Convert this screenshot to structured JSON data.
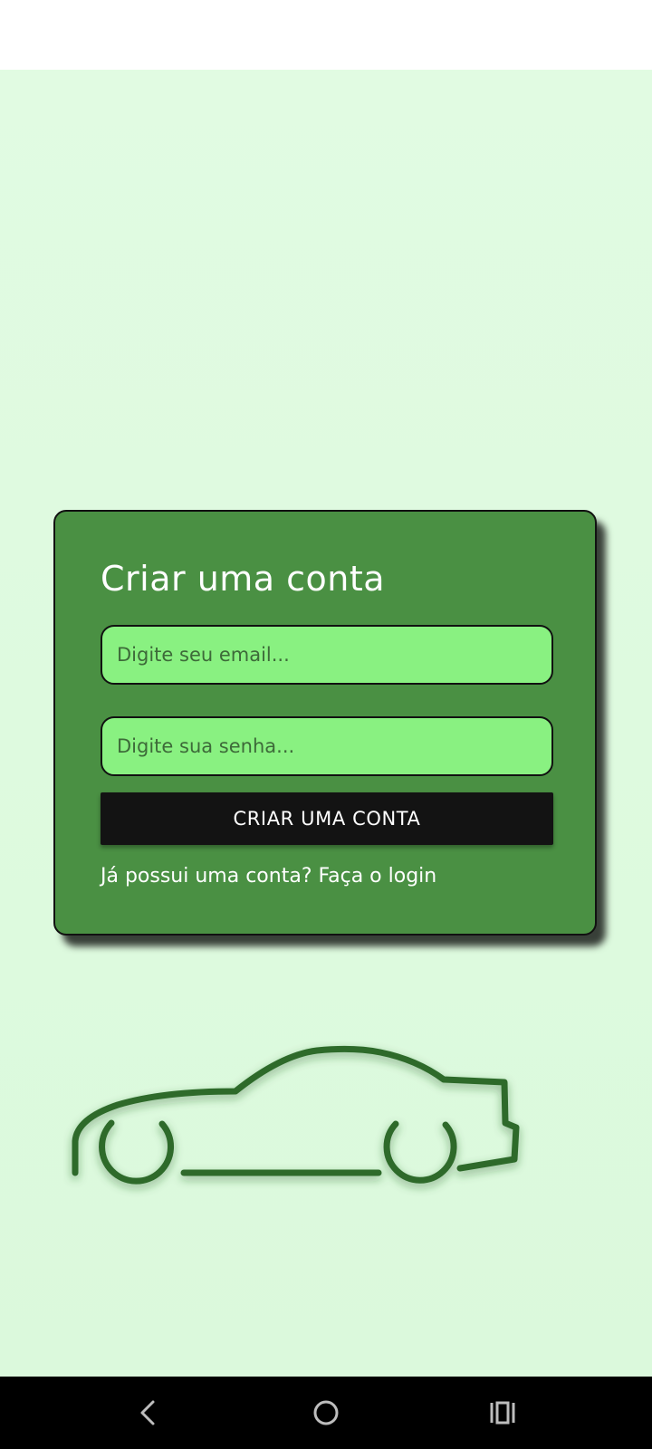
{
  "signup": {
    "title": "Criar uma conta",
    "email_placeholder": "Digite seu email...",
    "password_placeholder": "Digite sua senha...",
    "submit_label": "CRIAR UMA CONTA",
    "login_link": "Já possui uma conta? Faça o login"
  },
  "illustration": {
    "icon": "car-icon"
  },
  "navigation_bar": {
    "buttons": [
      "back-icon",
      "home-icon",
      "recents-icon"
    ]
  },
  "colors": {
    "background": "#e1fbe2",
    "card": "#4a9043",
    "input": "#89f181",
    "button": "#131313",
    "car_stroke": "#2d6a2c"
  }
}
